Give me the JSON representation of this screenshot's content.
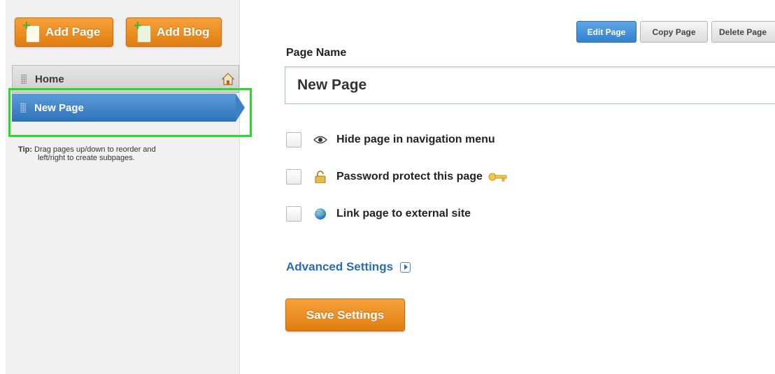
{
  "sidebar": {
    "add_page_label": "Add Page",
    "add_blog_label": "Add Blog",
    "pages": [
      {
        "label": "Home",
        "is_home": true,
        "selected": false
      },
      {
        "label": "New Page",
        "is_home": false,
        "selected": true
      }
    ],
    "tip": {
      "prefix": "Tip:",
      "line1": "Drag pages up/down to reorder and",
      "line2": "left/right to create subpages."
    }
  },
  "toolbar": {
    "edit_label": "Edit Page",
    "copy_label": "Copy Page",
    "delete_label": "Delete Page"
  },
  "form": {
    "page_name_label": "Page Name",
    "page_name_value": "New Page",
    "options": [
      {
        "label": "Hide page in navigation menu",
        "icon": "eye-icon",
        "checked": false
      },
      {
        "label": "Password protect this page",
        "icon": "lock-icon",
        "checked": false
      },
      {
        "label": "Link page to external site",
        "icon": "globe-icon",
        "checked": false
      }
    ],
    "advanced_label": "Advanced Settings",
    "save_label": "Save Settings"
  },
  "colors": {
    "accent_orange": "#e8891c",
    "selected_blue": "#3d80c4",
    "link_blue": "#2a6db6",
    "highlight_green": "#2bd92b"
  }
}
